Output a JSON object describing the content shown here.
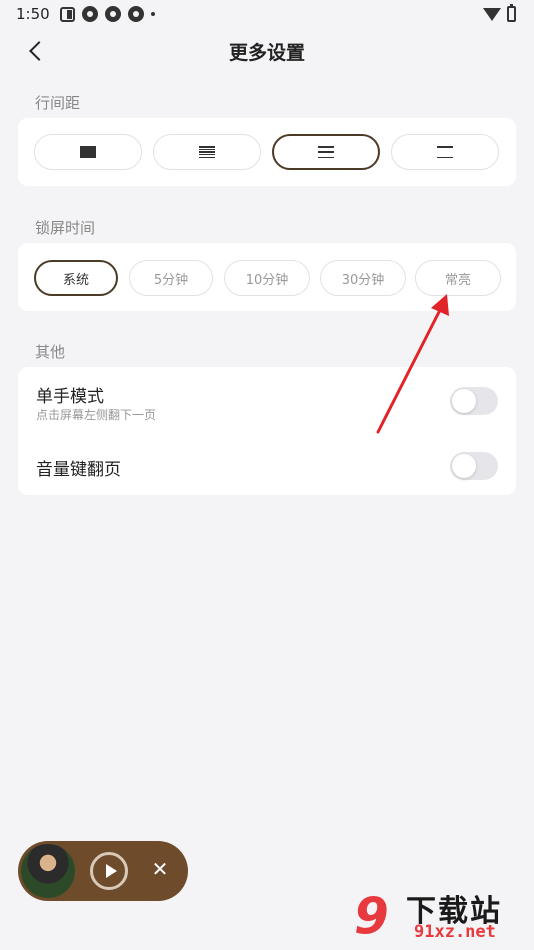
{
  "status_bar": {
    "time": "1:50"
  },
  "header": {
    "title": "更多设置"
  },
  "line_spacing": {
    "label": "行间距",
    "options": [
      {
        "lines": 6,
        "active": false
      },
      {
        "lines": 5,
        "active": false
      },
      {
        "lines": 3,
        "active": true
      },
      {
        "lines": 2,
        "active": false
      }
    ]
  },
  "lock_time": {
    "label": "锁屏时间",
    "options": [
      "系统",
      "5分钟",
      "10分钟",
      "30分钟",
      "常亮"
    ],
    "selected": "系统"
  },
  "other": {
    "label": "其他",
    "one_hand": {
      "title": "单手模式",
      "subtitle": "点击屏幕左侧翻下一页",
      "enabled": false
    },
    "volume_page": {
      "title": "音量键翻页",
      "enabled": false
    }
  },
  "player": {
    "close_symbol": "✕"
  },
  "watermark": {
    "text_main": "下载站",
    "text_url": "91xz.net"
  },
  "colors": {
    "accent": "#4b3b26",
    "player_bg": "#6e4b2a",
    "arrow": "#e0242a"
  }
}
